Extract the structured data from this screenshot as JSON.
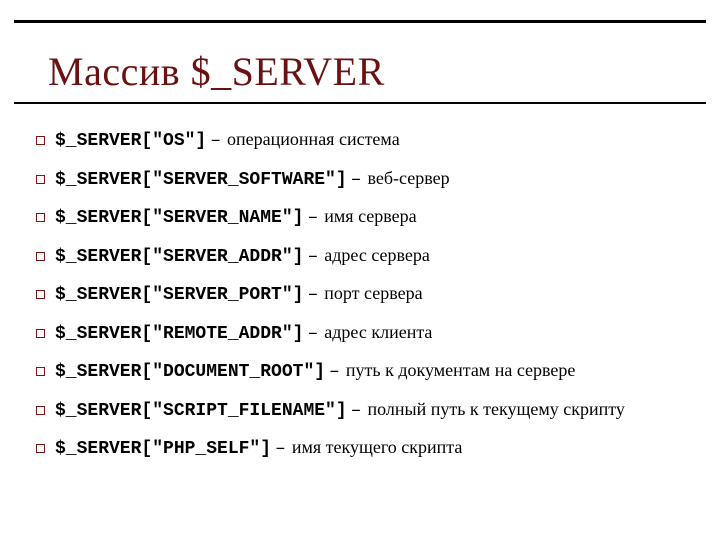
{
  "title": "Массив $_SERVER",
  "separator": " – ",
  "rows": [
    {
      "code": "$_SERVER[\"OS\"]",
      "desc": "операционная система"
    },
    {
      "code": "$_SERVER[\"SERVER_SOFTWARE\"]",
      "desc": "веб-сервер"
    },
    {
      "code": "$_SERVER[\"SERVER_NAME\"]",
      "desc": "имя сервера"
    },
    {
      "code": "$_SERVER[\"SERVER_ADDR\"]",
      "desc": "адрес сервера"
    },
    {
      "code": "$_SERVER[\"SERVER_PORT\"]",
      "desc": "порт сервера"
    },
    {
      "code": "$_SERVER[\"REMOTE_ADDR\"]",
      "desc": "адрес клиента"
    },
    {
      "code": "$_SERVER[\"DOCUMENT_ROOT\"]",
      "desc": "путь к документам на сервере"
    },
    {
      "code": "$_SERVER[\"SCRIPT_FILENAME\"]",
      "desc": "полный путь к текущему скрипту"
    },
    {
      "code": "$_SERVER[\"PHP_SELF\"]",
      "desc": "имя текущего скрипта"
    }
  ]
}
